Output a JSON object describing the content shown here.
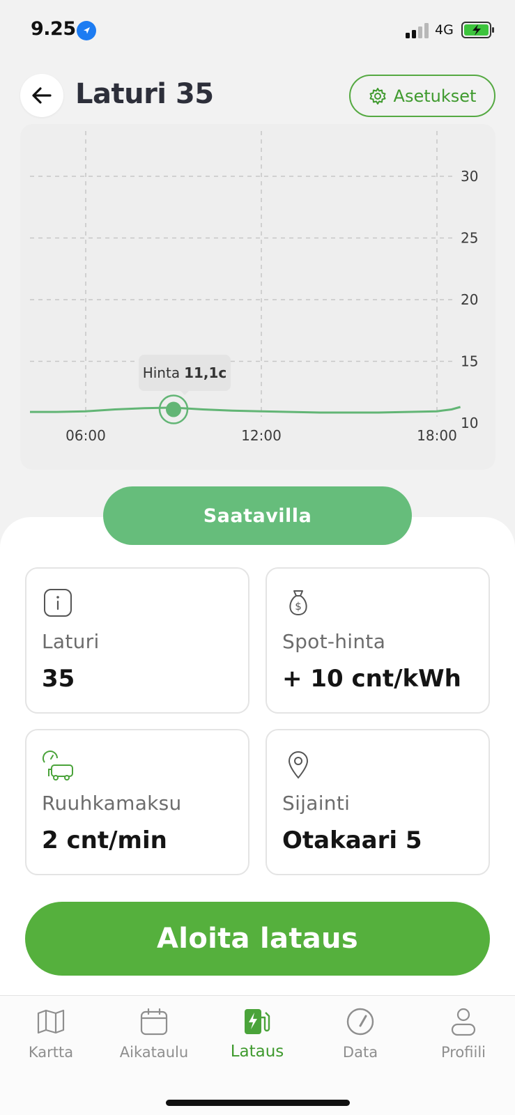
{
  "status_bar": {
    "time": "9.25",
    "network": "4G",
    "location_icon": "location-arrow-icon",
    "battery_state": "charging"
  },
  "header": {
    "title": "Laturi 35",
    "settings_label": "Asetukset"
  },
  "chart_data": {
    "type": "line",
    "x_ticks": [
      "06:00",
      "12:00",
      "18:00"
    ],
    "y_ticks": [
      10,
      15,
      20,
      25,
      30
    ],
    "ylim": [
      10,
      32
    ],
    "x_hours": [
      3.0,
      4.0,
      5.0,
      6.0,
      7.0,
      8.0,
      9.0,
      10.0,
      11.0,
      12.0,
      13.0,
      14.0,
      15.0,
      16.0,
      17.0,
      18.0,
      18.5,
      18.8
    ],
    "values": [
      10.9,
      10.9,
      10.9,
      10.95,
      11.1,
      11.2,
      11.25,
      11.1,
      11.0,
      10.95,
      10.9,
      10.85,
      10.85,
      10.85,
      10.9,
      10.95,
      11.1,
      11.3
    ],
    "highlight": {
      "x_hour": 9.0,
      "value": 11.1,
      "label": "Hinta",
      "value_label": "11,1c"
    },
    "grid": true,
    "line_color": "#62b575"
  },
  "availability": {
    "label": "Saatavilla"
  },
  "cards": [
    {
      "icon": "info-icon",
      "label": "Laturi",
      "value": "35"
    },
    {
      "icon": "money-bag-icon",
      "label": "Spot-hinta",
      "value": "+ 10 cnt/kWh"
    },
    {
      "icon": "congestion-fee-icon",
      "label": "Ruuhkamaksu",
      "value": "2 cnt/min"
    },
    {
      "icon": "location-pin-icon",
      "label": "Sijainti",
      "value": "Otakaari 5"
    }
  ],
  "start_button": {
    "label": "Aloita lataus"
  },
  "tabs": [
    {
      "icon": "map-icon",
      "label": "Kartta",
      "active": false
    },
    {
      "icon": "calendar-icon",
      "label": "Aikataulu",
      "active": false
    },
    {
      "icon": "charging-station-icon",
      "label": "Lataus",
      "active": true
    },
    {
      "icon": "speedometer-icon",
      "label": "Data",
      "active": false
    },
    {
      "icon": "profile-icon",
      "label": "Profiili",
      "active": false
    }
  ],
  "colors": {
    "accent": "#55b03d",
    "status_available": "#66bd7b",
    "tab_inactive": "#8e8e8e"
  }
}
